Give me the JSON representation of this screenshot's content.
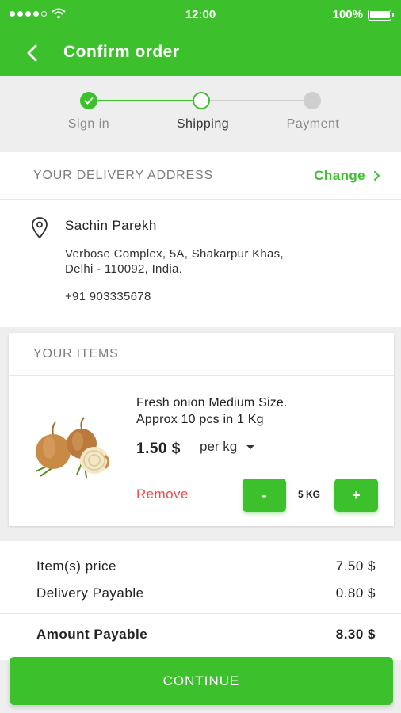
{
  "status_bar": {
    "time": "12:00",
    "battery_text": "100%",
    "signal_icon": "signal-dots-icon",
    "wifi_icon": "wifi-icon",
    "battery_icon": "battery-icon"
  },
  "header": {
    "title": "Confirm order",
    "back_icon": "back-chevron-icon"
  },
  "stepper": {
    "steps": [
      {
        "label": "Sign in",
        "state": "complete"
      },
      {
        "label": "Shipping",
        "state": "current"
      },
      {
        "label": "Payment",
        "state": "pending"
      }
    ]
  },
  "address": {
    "section_title": "YOUR DELIVERY ADDRESS",
    "change_label": "Change",
    "name": "Sachin Parekh",
    "line1": "Verbose Complex, 5A, Shakarpur Khas,",
    "line2": "Delhi - 110092, India.",
    "phone": "+91 903335678"
  },
  "items": {
    "section_title": "YOUR ITEMS",
    "list": [
      {
        "name_line1": "Fresh onion Medium Size.",
        "name_line2": "Approx 10 pcs in 1 Kg",
        "price": "1.50 $",
        "unit": "per kg",
        "remove_label": "Remove",
        "minus_label": "-",
        "quantity": "5 KG",
        "plus_label": "+"
      }
    ]
  },
  "summary": {
    "item_price_label": "Item(s) price",
    "item_price_value": "7.50 $",
    "delivery_label": "Delivery Payable",
    "delivery_value": "0.80 $",
    "total_label": "Amount Payable",
    "total_value": "8.30 $"
  },
  "continue_label": "CONTINUE",
  "colors": {
    "brand_green": "#3cc12d",
    "remove_red": "#f04a4a",
    "background": "#eeeeee"
  }
}
